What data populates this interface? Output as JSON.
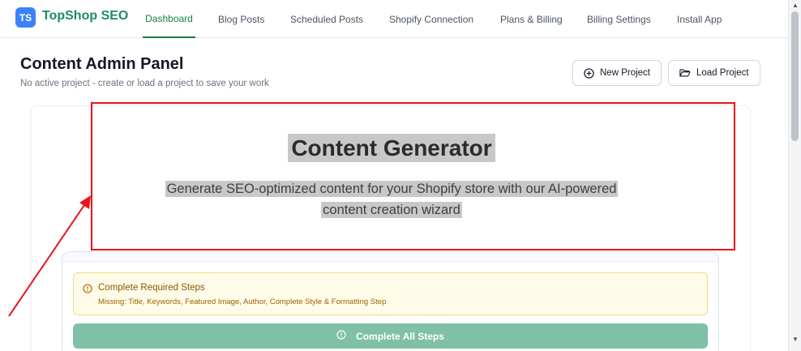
{
  "brand": {
    "badge": "TS",
    "name": "TopShop SEO"
  },
  "nav": {
    "tabs": [
      {
        "label": "Dashboard",
        "active": true
      },
      {
        "label": "Blog Posts"
      },
      {
        "label": "Scheduled Posts"
      },
      {
        "label": "Shopify Connection"
      },
      {
        "label": "Plans & Billing"
      },
      {
        "label": "Billing Settings"
      },
      {
        "label": "Install App"
      }
    ]
  },
  "header": {
    "title": "Content Admin Panel",
    "subtitle": "No active project - create or load a project to save your work",
    "new_project_label": "New Project",
    "load_project_label": "Load Project"
  },
  "hero": {
    "title": "Content Generator",
    "description_line1": "Generate SEO-optimized content for your Shopify store with our AI-powered",
    "description_line2": "content creation wizard"
  },
  "alert": {
    "title": "Complete Required Steps",
    "text": "Missing: Title, Keywords, Featured Image, Author, Complete Style & Formatting Step"
  },
  "cta": {
    "label": "Complete All Steps"
  },
  "colors": {
    "brand_blue": "#3b82f6",
    "brand_green": "#1f8a6a",
    "active_tab": "#15803d",
    "annotation_red": "#e8141c",
    "cta_green": "#7fc0a6",
    "alert_bg": "#fefbe8"
  },
  "icons": {
    "new_project": "plus-circle-icon",
    "load_project": "folder-open-icon",
    "alert": "alert-circle-icon",
    "cta": "alert-circle-icon"
  }
}
